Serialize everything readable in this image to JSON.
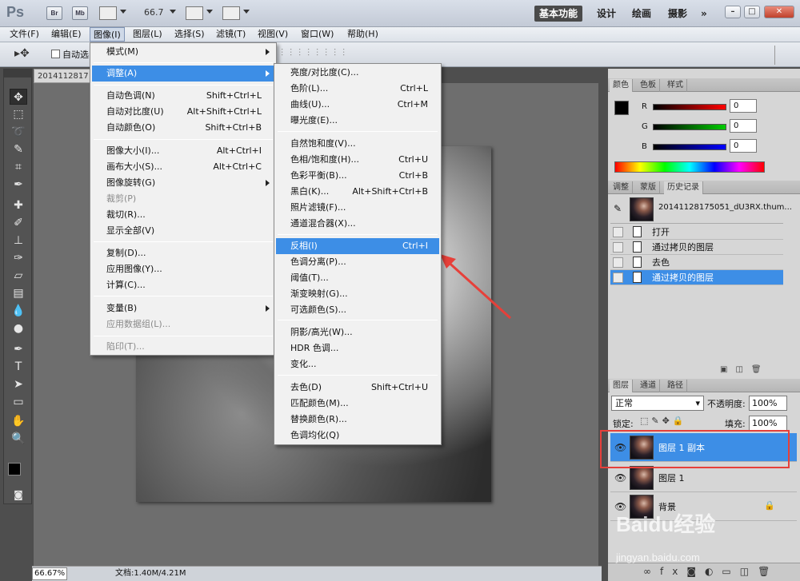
{
  "app": {
    "logo": "Ps",
    "bridge": "Br",
    "minibridge": "Mb",
    "zoom": "66.7"
  },
  "workspaces": [
    "基本功能",
    "设计",
    "绘画",
    "摄影"
  ],
  "menubar": [
    "文件(F)",
    "编辑(E)",
    "图像(I)",
    "图层(L)",
    "选择(S)",
    "滤镜(T)",
    "视图(V)",
    "窗口(W)",
    "帮助(H)"
  ],
  "options": {
    "auto_select": "自动选"
  },
  "document": {
    "tab": "2014112817",
    "zoom": "66.67%",
    "docsize": "文档:1.40M/4.21M"
  },
  "image_menu": [
    {
      "label": "模式(M)",
      "submenu": true
    },
    {
      "label": "调整(A)",
      "submenu": true,
      "highlight": true
    },
    {
      "label": "自动色调(N)",
      "shortcut": "Shift+Ctrl+L"
    },
    {
      "label": "自动对比度(U)",
      "shortcut": "Alt+Shift+Ctrl+L"
    },
    {
      "label": "自动颜色(O)",
      "shortcut": "Shift+Ctrl+B"
    },
    {
      "label": "图像大小(I)...",
      "shortcut": "Alt+Ctrl+I"
    },
    {
      "label": "画布大小(S)...",
      "shortcut": "Alt+Ctrl+C"
    },
    {
      "label": "图像旋转(G)",
      "submenu": true
    },
    {
      "label": "裁剪(P)",
      "disabled": true
    },
    {
      "label": "裁切(R)..."
    },
    {
      "label": "显示全部(V)"
    },
    {
      "label": "复制(D)..."
    },
    {
      "label": "应用图像(Y)..."
    },
    {
      "label": "计算(C)..."
    },
    {
      "label": "变量(B)",
      "submenu": true
    },
    {
      "label": "应用数据组(L)...",
      "disabled": true
    },
    {
      "label": "陷印(T)...",
      "disabled": true
    }
  ],
  "adjust_menu": [
    {
      "label": "亮度/对比度(C)..."
    },
    {
      "label": "色阶(L)...",
      "shortcut": "Ctrl+L"
    },
    {
      "label": "曲线(U)...",
      "shortcut": "Ctrl+M"
    },
    {
      "label": "曝光度(E)..."
    },
    {
      "label": "自然饱和度(V)..."
    },
    {
      "label": "色相/饱和度(H)...",
      "shortcut": "Ctrl+U"
    },
    {
      "label": "色彩平衡(B)...",
      "shortcut": "Ctrl+B"
    },
    {
      "label": "黑白(K)...",
      "shortcut": "Alt+Shift+Ctrl+B"
    },
    {
      "label": "照片滤镜(F)..."
    },
    {
      "label": "通道混合器(X)..."
    },
    {
      "label": "反相(I)",
      "shortcut": "Ctrl+I",
      "highlight": true
    },
    {
      "label": "色调分离(P)..."
    },
    {
      "label": "阈值(T)..."
    },
    {
      "label": "渐变映射(G)..."
    },
    {
      "label": "可选颜色(S)..."
    },
    {
      "label": "阴影/高光(W)..."
    },
    {
      "label": "HDR 色调..."
    },
    {
      "label": "变化..."
    },
    {
      "label": "去色(D)",
      "shortcut": "Shift+Ctrl+U"
    },
    {
      "label": "匹配颜色(M)..."
    },
    {
      "label": "替换颜色(R)..."
    },
    {
      "label": "色调均化(Q)"
    }
  ],
  "color_panel": {
    "tabs": [
      "颜色",
      "色板",
      "样式"
    ],
    "channels": [
      {
        "name": "R",
        "value": "0"
      },
      {
        "name": "G",
        "value": "0"
      },
      {
        "name": "B",
        "value": "0"
      }
    ]
  },
  "history_panel": {
    "tabs": [
      "调整",
      "蒙版",
      "历史记录"
    ],
    "snapshot": "20141128175051_dU3RX.thum...",
    "items": [
      "打开",
      "通过拷贝的图层",
      "去色",
      "通过拷贝的图层"
    ]
  },
  "layers_panel": {
    "tabs": [
      "图层",
      "通道",
      "路径"
    ],
    "blend": "正常",
    "opacity_label": "不透明度:",
    "opacity": "100%",
    "lock_label": "锁定:",
    "fill_label": "填充:",
    "fill": "100%",
    "layers": [
      "图层 1 副本",
      "图层 1",
      "背景"
    ]
  },
  "watermark": {
    "main": "Baidu经验",
    "sub": "jingyan.baidu.com"
  }
}
